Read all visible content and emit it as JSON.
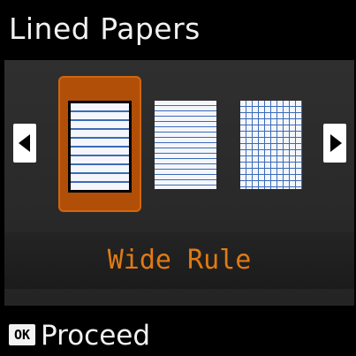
{
  "screen": {
    "title": "Lined Papers",
    "selected_option": "Wide Rule",
    "options": [
      {
        "name": "wide-rule",
        "selected": true
      },
      {
        "name": "narrow-rule",
        "selected": false
      },
      {
        "name": "graph-paper",
        "selected": false
      }
    ],
    "nav": {
      "left_icon": "arrow-left-icon",
      "right_icon": "arrow-right-icon"
    }
  },
  "footer": {
    "ok_key": "OK",
    "action_label": "Proceed"
  },
  "colors": {
    "background": "#000000",
    "panel": "#2b2b2b",
    "accent": "#b14f09",
    "label": "#e07a14",
    "rule_line": "#3b6bb8"
  }
}
